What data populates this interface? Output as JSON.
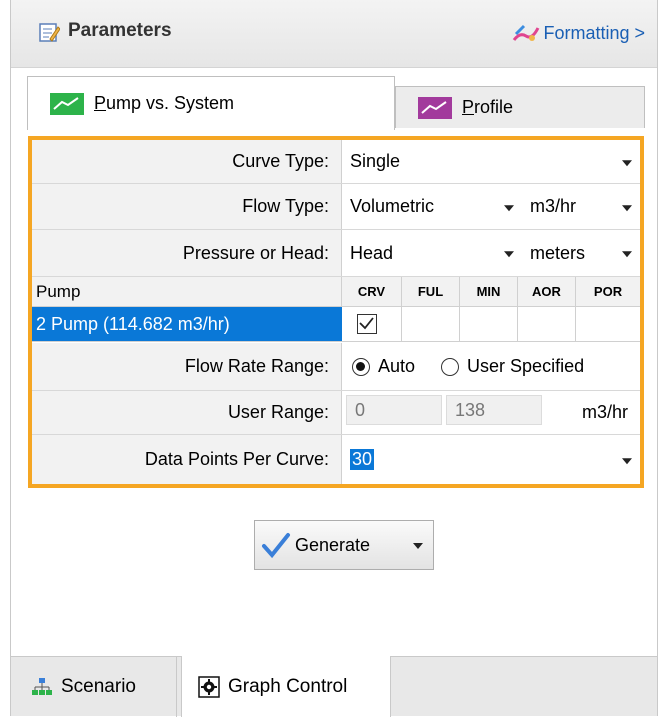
{
  "header": {
    "title": "Parameters",
    "formatting_label": "Formatting >"
  },
  "tabs": [
    {
      "label_underlined": "P",
      "label_rest": "ump vs. System",
      "active": true
    },
    {
      "label_underlined": "P",
      "label_rest": "rofile",
      "active": false
    }
  ],
  "fields": {
    "curve_type": {
      "label": "Curve Type:",
      "value": "Single"
    },
    "flow_type": {
      "label": "Flow Type:",
      "value": "Volumetric",
      "unit": "m3/hr"
    },
    "pressure_or_head": {
      "label": "Pressure or Head:",
      "value": "Head",
      "unit": "meters"
    },
    "flow_rate_range": {
      "label": "Flow Rate Range:",
      "option_auto": "Auto",
      "option_user": "User Specified",
      "selected": "Auto"
    },
    "user_range": {
      "label": "User Range:",
      "min": "0",
      "max": "138",
      "unit": "m3/hr"
    },
    "data_points": {
      "label": "Data Points Per Curve:",
      "value": "30"
    }
  },
  "pump_table": {
    "columns": [
      "Pump",
      "CRV",
      "FUL",
      "MIN",
      "AOR",
      "POR"
    ],
    "rows": [
      {
        "name": "2  Pump  (114.682 m3/hr)",
        "CRV": true,
        "FUL": false,
        "MIN": false,
        "AOR": false,
        "POR": false
      }
    ]
  },
  "actions": {
    "generate_label": "Generate"
  },
  "bottom_tabs": [
    {
      "label": "Scenario",
      "active": false
    },
    {
      "label": "Graph Control",
      "active": true
    }
  ],
  "colors": {
    "accent_frame": "#f5a623",
    "selection": "#0a78d7",
    "link": "#1a5fb4"
  }
}
